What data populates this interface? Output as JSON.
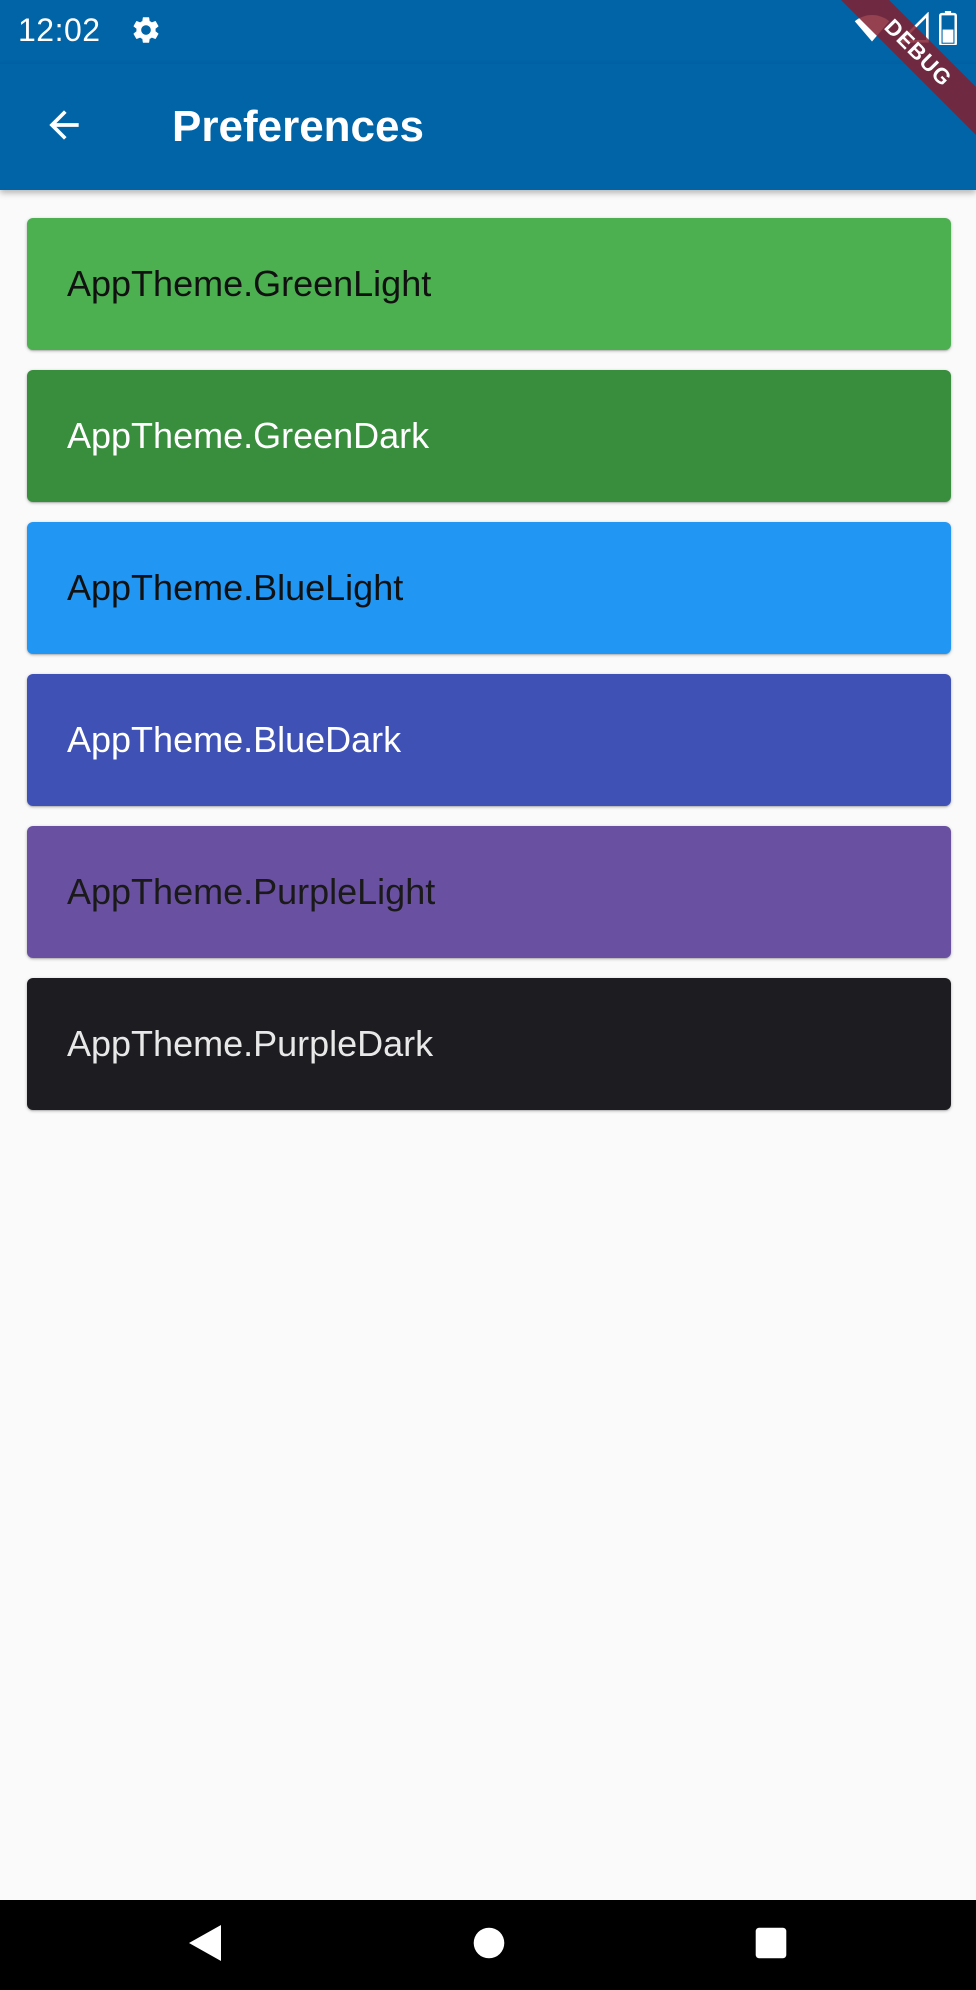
{
  "status_bar": {
    "time": "12:02",
    "icons": [
      "settings-icon",
      "wifi-icon",
      "signal-icon",
      "battery-icon"
    ]
  },
  "app_bar": {
    "title": "Preferences",
    "back_icon": "arrow-back-icon"
  },
  "debug_banner": "DEBUG",
  "themes": [
    {
      "label": "AppTheme.GreenLight",
      "background": "#4caf50",
      "text_color": "#111111"
    },
    {
      "label": "AppTheme.GreenDark",
      "background": "#388e3c",
      "text_color": "#ffffff"
    },
    {
      "label": "AppTheme.BlueLight",
      "background": "#2196f3",
      "text_color": "#111111"
    },
    {
      "label": "AppTheme.BlueDark",
      "background": "#3f51b5",
      "text_color": "#ffffff"
    },
    {
      "label": "AppTheme.PurpleLight",
      "background": "#6a50a1",
      "text_color": "#1a1a1a"
    },
    {
      "label": "AppTheme.PurpleDark",
      "background": "#1d1c21",
      "text_color": "#e8e8e8"
    }
  ],
  "nav_bar": {
    "buttons": [
      "nav-back-icon",
      "nav-home-icon",
      "nav-recents-icon"
    ]
  },
  "colors": {
    "primary": "#0064a7",
    "background": "#fafafa",
    "debug_ribbon": "#822030"
  }
}
